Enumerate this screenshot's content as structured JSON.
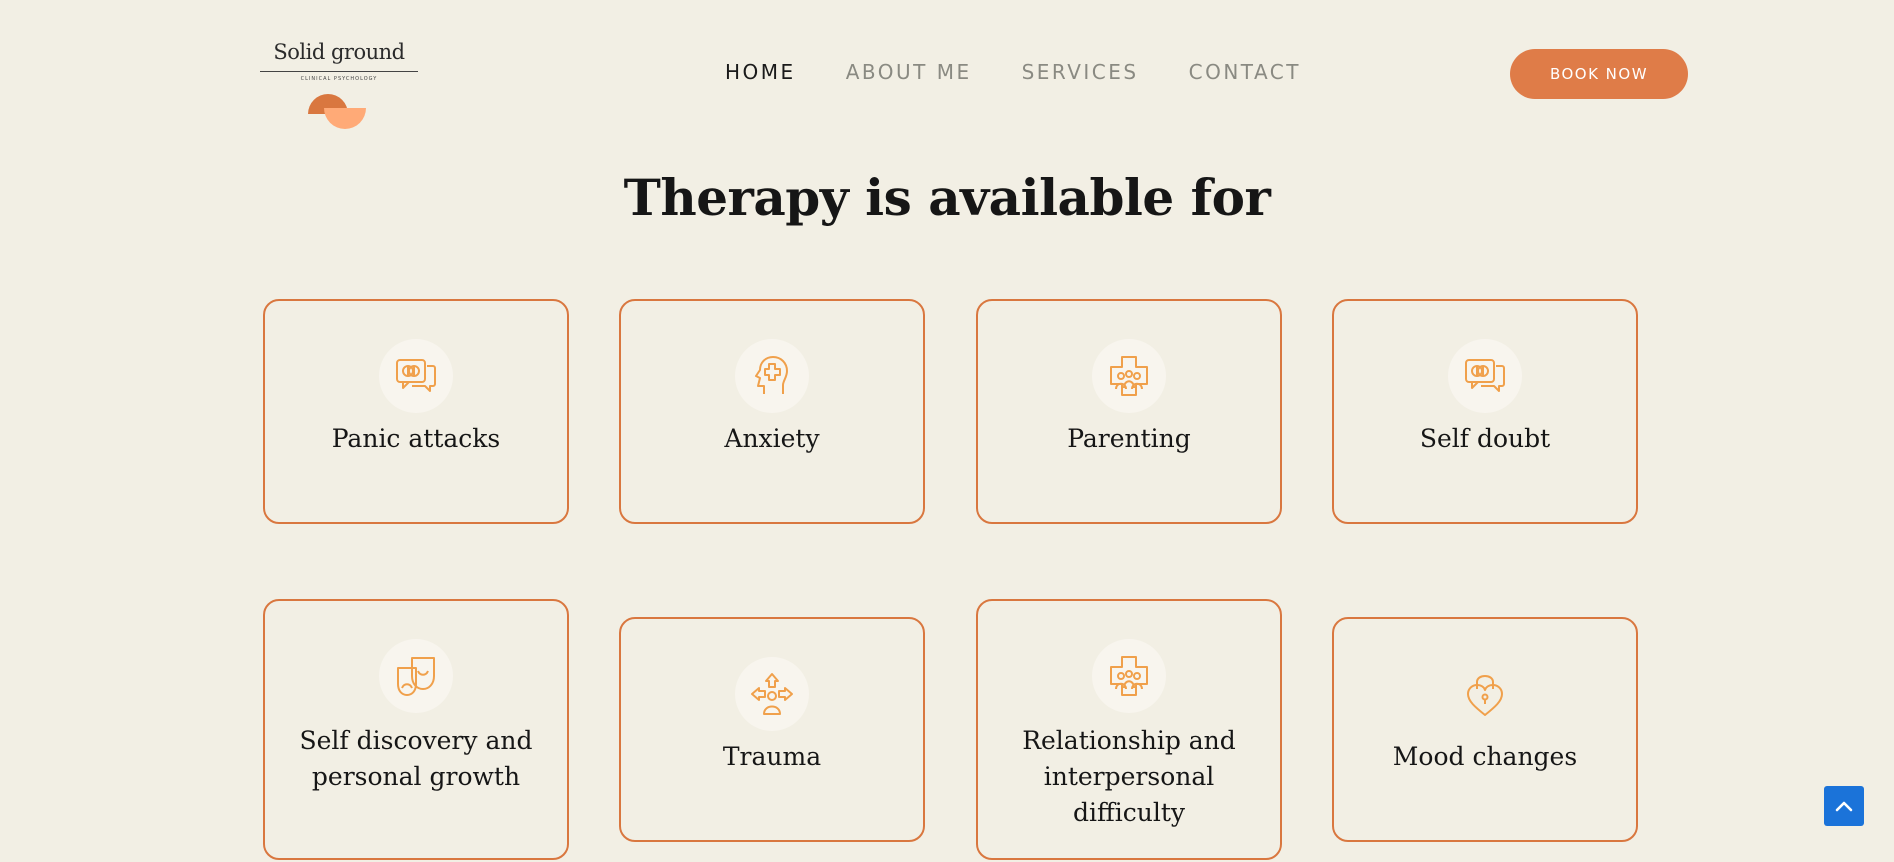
{
  "logo": {
    "name": "Solid ground",
    "tagline": "CLINICAL PSYCHOLOGY",
    "colors": {
      "dark": "#D9773F",
      "light": "#FFAA77"
    }
  },
  "nav": {
    "items": [
      {
        "label": "HOME",
        "active": true
      },
      {
        "label": "ABOUT ME",
        "active": false
      },
      {
        "label": "SERVICES",
        "active": false
      },
      {
        "label": "CONTACT",
        "active": false
      }
    ],
    "cta_label": "BOOK NOW"
  },
  "main": {
    "title": "Therapy is available for",
    "cards": [
      {
        "label": "Panic attacks",
        "icon": "speech-bubbles-brain-icon"
      },
      {
        "label": "Anxiety",
        "icon": "head-puzzle-icon"
      },
      {
        "label": "Parenting",
        "icon": "family-cross-icon"
      },
      {
        "label": "Self doubt",
        "icon": "speech-bubbles-brain-icon"
      },
      {
        "label": "Self discovery and personal growth",
        "icon": "theater-masks-icon"
      },
      {
        "label": "Trauma",
        "icon": "person-arrows-icon"
      },
      {
        "label": "Relationship and interpersonal difficulty",
        "icon": "family-cross-icon"
      },
      {
        "label": "Mood changes",
        "icon": "heart-lock-icon"
      }
    ]
  },
  "colors": {
    "accent": "#DF7C48",
    "border": "#D9773F",
    "icon": "#F0A04B",
    "background": "#F2EFE4",
    "scroll_button": "#1B73D9"
  },
  "scroll_top_icon": "chevron-up-icon"
}
